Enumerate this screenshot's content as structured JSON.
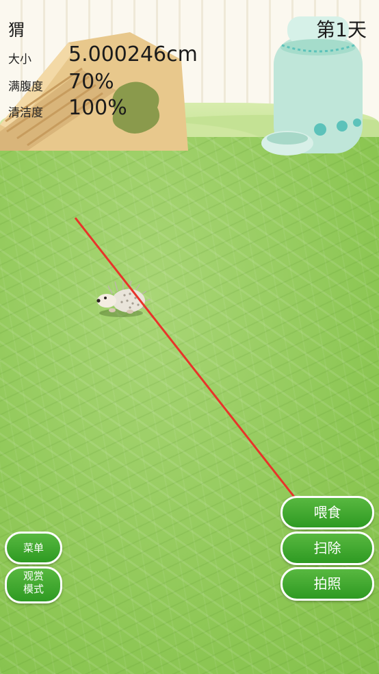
{
  "hud": {
    "pet_name": "猬",
    "day": "第1天",
    "size_label": "大小",
    "size_value": "5.000246cm",
    "fullness_label": "满腹度",
    "fullness_value": "70%",
    "cleanliness_label": "清洁度",
    "cleanliness_value": "100%"
  },
  "actions": {
    "feed": "喂食",
    "clean": "扫除",
    "photo": "拍照"
  },
  "side_menu": {
    "menu": "菜单",
    "watch_mode_line1": "观赏",
    "watch_mode_line2": "模式"
  },
  "colors": {
    "button_green": "#3ea82c",
    "hay_green": "#8cc653",
    "arrow_red": "#e8332a"
  },
  "icons": {
    "house": "wooden-hideout-icon",
    "bottle": "water-bottle-icon",
    "pet": "hedgehog-icon"
  }
}
